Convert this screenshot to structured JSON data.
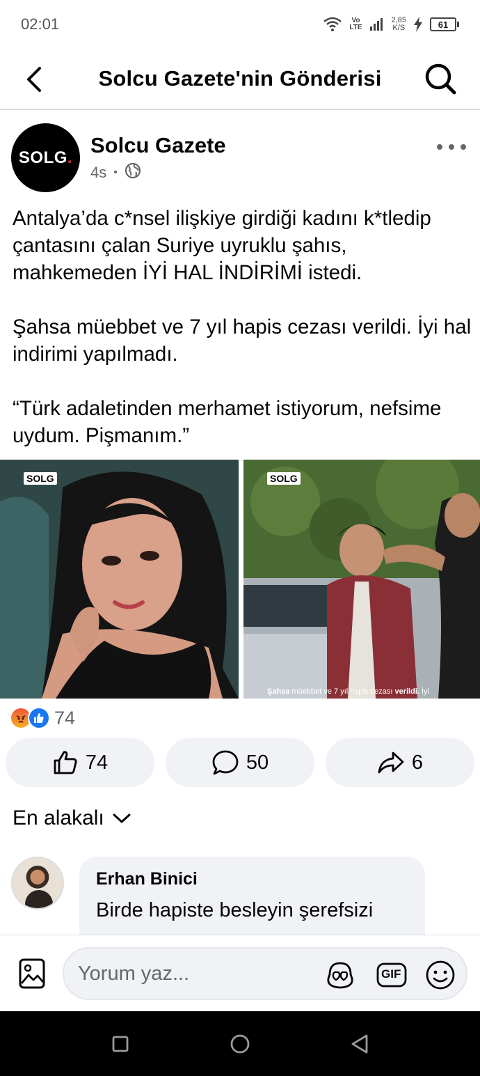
{
  "status": {
    "time": "02:01",
    "volte_top": "Vo",
    "volte_bottom": "LTE",
    "speed_top": "2,85",
    "speed_bottom": "K/S",
    "battery": "61"
  },
  "header": {
    "title": "Solcu Gazete'nin Gönderisi"
  },
  "post": {
    "avatar_text": "SOLG",
    "avatar_dot": ".",
    "page_name": "Solcu Gazete",
    "time": "4s",
    "meta_dot": "•",
    "paragraphs": [
      "Antalya’da c*nsel ilişkiye girdiği kadını k*tledip çantasını çalan Suriye uyruklu şahıs, mahkemeden İYİ HAL İNDİRİMİ istedi.",
      "Şahsa müebbet ve 7 yıl hapis cezası verildi. İyi hal indirimi yapılmadı.",
      "“Türk adaletinden merhamet istiyorum, nefsime uydum. Pişmanım.”"
    ],
    "images": [
      {
        "badge": "SOLG"
      },
      {
        "badge": "SOLG",
        "caption_bold1": "Şahsa",
        "caption_mid": " müebbet ve 7 yıl hapis cezası ",
        "caption_bold2": "verildi.",
        "caption_end": " İyi"
      }
    ],
    "reaction_count": "74",
    "actions": {
      "like_count": "74",
      "comment_count": "50",
      "share_count": "6"
    }
  },
  "sort": {
    "label": "En alakalı"
  },
  "comment": {
    "author": "Erhan Binici",
    "text": "Birde hapiste besleyin şerefsizi"
  },
  "composer": {
    "placeholder": "Yorum yaz...",
    "gif_label": "GIF"
  },
  "colors": {
    "brand_blue": "#1877f2",
    "secondary_text": "#65676b",
    "bubble_bg": "#f0f2f5"
  }
}
